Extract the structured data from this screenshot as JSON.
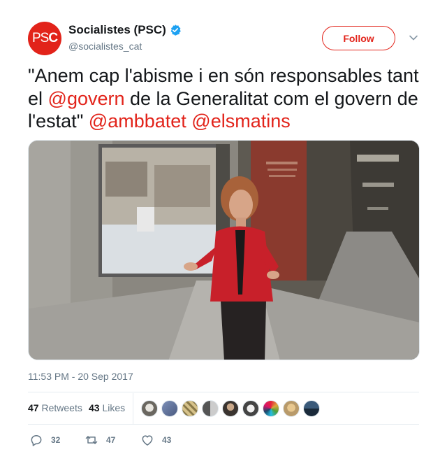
{
  "account": {
    "avatar_text_light": "PS",
    "avatar_text_bold": "C",
    "display_name": "Socialistes (PSC)",
    "handle": "@socialistes_cat",
    "verified_icon": "verified-badge-icon",
    "brand_color": "#e2231a",
    "follow_label": "Follow"
  },
  "tweet": {
    "text_1": "\"Anem cap l'abisme i en són responsables tant el ",
    "mention_1": "@govern",
    "text_2": " de la Generalitat com el govern de l'estat\" ",
    "mention_2": "@ambbatet",
    "text_3": " ",
    "mention_3": "@elsmatins",
    "timestamp": "11:53 PM - 20 Sep 2017"
  },
  "stats": {
    "retweets_count": "47",
    "retweets_label": "Retweets",
    "likes_count": "43",
    "likes_label": "Likes"
  },
  "actions": {
    "replies": "32",
    "retweets": "47",
    "likes": "43"
  }
}
